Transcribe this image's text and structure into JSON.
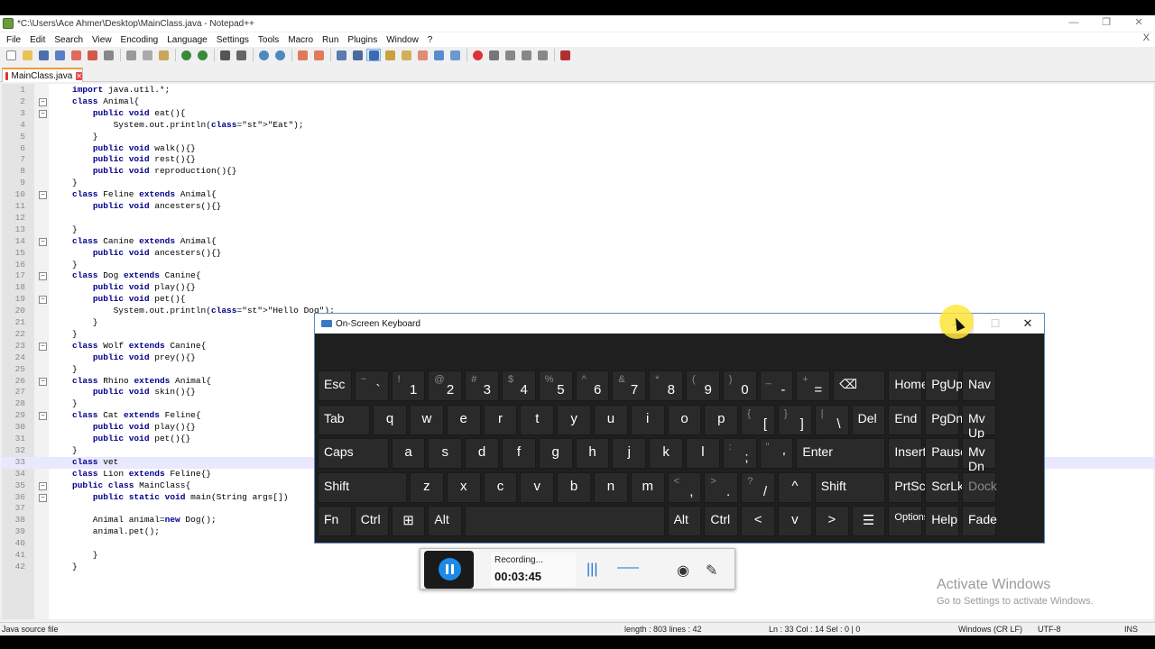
{
  "window": {
    "title": "*C:\\Users\\Ace Ahmer\\Desktop\\MainClass.java - Notepad++",
    "controls": [
      "—",
      "❐",
      "✕"
    ]
  },
  "menu": [
    "File",
    "Edit",
    "Search",
    "View",
    "Encoding",
    "Language",
    "Settings",
    "Tools",
    "Macro",
    "Run",
    "Plugins",
    "Window",
    "?"
  ],
  "menu_close": "X",
  "tab": {
    "label": "MainClass.java"
  },
  "editor": {
    "current_line": 33,
    "lines": [
      {
        "n": "1",
        "code": "import java.util.*;"
      },
      {
        "n": "2",
        "code": "class Animal{",
        "fold": "minus"
      },
      {
        "n": "3",
        "code": "    public void eat(){",
        "fold": "minus"
      },
      {
        "n": "4",
        "code": "        System.out.println(\"Eat\");"
      },
      {
        "n": "5",
        "code": "    }"
      },
      {
        "n": "6",
        "code": "    public void walk(){}"
      },
      {
        "n": "7",
        "code": "    public void rest(){}"
      },
      {
        "n": "8",
        "code": "    public void reproduction(){}"
      },
      {
        "n": "9",
        "code": "}"
      },
      {
        "n": "10",
        "code": "class Feline extends Animal{",
        "fold": "minus"
      },
      {
        "n": "11",
        "code": "    public void ancesters(){}"
      },
      {
        "n": "12",
        "code": ""
      },
      {
        "n": "13",
        "code": "}"
      },
      {
        "n": "14",
        "code": "class Canine extends Animal{",
        "fold": "minus"
      },
      {
        "n": "15",
        "code": "    public void ancesters(){}"
      },
      {
        "n": "16",
        "code": "}"
      },
      {
        "n": "17",
        "code": "class Dog extends Canine{",
        "fold": "minus"
      },
      {
        "n": "18",
        "code": "    public void play(){}"
      },
      {
        "n": "19",
        "code": "    public void pet(){",
        "fold": "minus"
      },
      {
        "n": "20",
        "code": "        System.out.println(\"Hello Dog\");"
      },
      {
        "n": "21",
        "code": "    }"
      },
      {
        "n": "22",
        "code": "}"
      },
      {
        "n": "23",
        "code": "class Wolf extends Canine{",
        "fold": "minus"
      },
      {
        "n": "24",
        "code": "    public void prey(){}"
      },
      {
        "n": "25",
        "code": "}"
      },
      {
        "n": "26",
        "code": "class Rhino extends Animal{",
        "fold": "minus"
      },
      {
        "n": "27",
        "code": "    public void skin(){}"
      },
      {
        "n": "28",
        "code": "}"
      },
      {
        "n": "29",
        "code": "class Cat extends Feline{",
        "fold": "minus"
      },
      {
        "n": "30",
        "code": "    public void play(){}"
      },
      {
        "n": "31",
        "code": "    public void pet(){}"
      },
      {
        "n": "32",
        "code": "}"
      },
      {
        "n": "33",
        "code": "class vet"
      },
      {
        "n": "34",
        "code": "class Lion extends Feline{}"
      },
      {
        "n": "35",
        "code": "public class MainClass{",
        "fold": "minus"
      },
      {
        "n": "36",
        "code": "    public static void main(String args[])",
        "fold": "minus"
      },
      {
        "n": "37",
        "code": ""
      },
      {
        "n": "38",
        "code": "    Animal animal=new Dog();"
      },
      {
        "n": "39",
        "code": "    animal.pet();"
      },
      {
        "n": "40",
        "code": ""
      },
      {
        "n": "41",
        "code": "    }"
      },
      {
        "n": "42",
        "code": "}"
      }
    ]
  },
  "status": {
    "file_type": "Java source file",
    "length": "length : 803    lines : 42",
    "position": "Ln : 33    Col : 14    Sel : 0 | 0",
    "eol": "Windows (CR LF)",
    "encoding": "UTF-8",
    "mode": "INS"
  },
  "osk": {
    "title": "On-Screen Keyboard",
    "controls": {
      "minimize": "—",
      "maximize": "☐",
      "close": "✕"
    },
    "rows": [
      [
        {
          "label": "Esc",
          "w": 1
        },
        {
          "shift": "~",
          "base": "`",
          "w": 1
        },
        {
          "shift": "!",
          "base": "1",
          "w": 1
        },
        {
          "shift": "@",
          "base": "2",
          "w": 1
        },
        {
          "shift": "#",
          "base": "3",
          "w": 1
        },
        {
          "shift": "$",
          "base": "4",
          "w": 1
        },
        {
          "shift": "%",
          "base": "5",
          "w": 1
        },
        {
          "shift": "^",
          "base": "6",
          "w": 1
        },
        {
          "shift": "&",
          "base": "7",
          "w": 1
        },
        {
          "shift": "*",
          "base": "8",
          "w": 1
        },
        {
          "shift": "(",
          "base": "9",
          "w": 1
        },
        {
          "shift": ")",
          "base": "0",
          "w": 1
        },
        {
          "shift": "_",
          "base": "-",
          "w": 1
        },
        {
          "shift": "+",
          "base": "=",
          "w": 1
        },
        {
          "label": "⌫",
          "w": 1.5
        },
        {
          "label": "Home",
          "w": 1
        },
        {
          "label": "PgUp",
          "w": 1
        },
        {
          "label": "Nav",
          "w": 1
        }
      ],
      [
        {
          "label": "Tab",
          "w": 1.5
        },
        {
          "center": "q",
          "w": 1
        },
        {
          "center": "w",
          "w": 1
        },
        {
          "center": "e",
          "w": 1
        },
        {
          "center": "r",
          "w": 1
        },
        {
          "center": "t",
          "w": 1
        },
        {
          "center": "y",
          "w": 1
        },
        {
          "center": "u",
          "w": 1
        },
        {
          "center": "i",
          "w": 1
        },
        {
          "center": "o",
          "w": 1
        },
        {
          "center": "p",
          "w": 1
        },
        {
          "shift": "{",
          "base": "[",
          "w": 1
        },
        {
          "shift": "}",
          "base": "]",
          "w": 1
        },
        {
          "shift": "|",
          "base": "\\",
          "w": 1
        },
        {
          "label": "Del",
          "w": 1
        },
        {
          "label": "End",
          "w": 1
        },
        {
          "label": "PgDn",
          "w": 1
        },
        {
          "label": "Mv Up",
          "w": 1
        }
      ],
      [
        {
          "label": "Caps",
          "w": 2
        },
        {
          "center": "a",
          "w": 1
        },
        {
          "center": "s",
          "w": 1
        },
        {
          "center": "d",
          "w": 1
        },
        {
          "center": "f",
          "w": 1
        },
        {
          "center": "g",
          "w": 1
        },
        {
          "center": "h",
          "w": 1
        },
        {
          "center": "j",
          "w": 1
        },
        {
          "center": "k",
          "w": 1
        },
        {
          "center": "l",
          "w": 1
        },
        {
          "shift": ":",
          "base": ";",
          "w": 1
        },
        {
          "shift": "\"",
          "base": "'",
          "w": 1
        },
        {
          "label": "Enter",
          "w": 2.5
        },
        {
          "label": "Insert",
          "w": 1
        },
        {
          "label": "Pause",
          "w": 1
        },
        {
          "label": "Mv Dn",
          "w": 1
        }
      ],
      [
        {
          "label": "Shift",
          "w": 2.5
        },
        {
          "center": "z",
          "w": 1
        },
        {
          "center": "x",
          "w": 1
        },
        {
          "center": "c",
          "w": 1
        },
        {
          "center": "v",
          "w": 1
        },
        {
          "center": "b",
          "w": 1
        },
        {
          "center": "n",
          "w": 1
        },
        {
          "center": "m",
          "w": 1
        },
        {
          "shift": "<",
          "base": ",",
          "w": 1
        },
        {
          "shift": ">",
          "base": ".",
          "w": 1
        },
        {
          "shift": "?",
          "base": "/",
          "w": 1
        },
        {
          "center": "^",
          "w": 1
        },
        {
          "label": "Shift",
          "w": 2
        },
        {
          "label": "PrtScn",
          "w": 1
        },
        {
          "label": "ScrLk",
          "w": 1
        },
        {
          "label": "Dock",
          "w": 1,
          "dim": true
        }
      ],
      [
        {
          "label": "Fn",
          "w": 1
        },
        {
          "label": "Ctrl",
          "w": 1
        },
        {
          "center": "⊞",
          "w": 1
        },
        {
          "label": "Alt",
          "w": 1
        },
        {
          "label": "",
          "w": 5.5
        },
        {
          "label": "Alt",
          "w": 1
        },
        {
          "label": "Ctrl",
          "w": 1
        },
        {
          "center": "<",
          "w": 1
        },
        {
          "center": "v",
          "w": 1
        },
        {
          "center": ">",
          "w": 1
        },
        {
          "center": "☰",
          "w": 1
        },
        {
          "label": "Options",
          "w": 1,
          "small": true
        },
        {
          "label": "Help",
          "w": 1
        },
        {
          "label": "Fade",
          "w": 1
        }
      ]
    ]
  },
  "recorder": {
    "status": "Recording...",
    "time": "00:03:45"
  },
  "watermark": {
    "line1": "Activate Windows",
    "line2": "Go to Settings to activate Windows."
  }
}
